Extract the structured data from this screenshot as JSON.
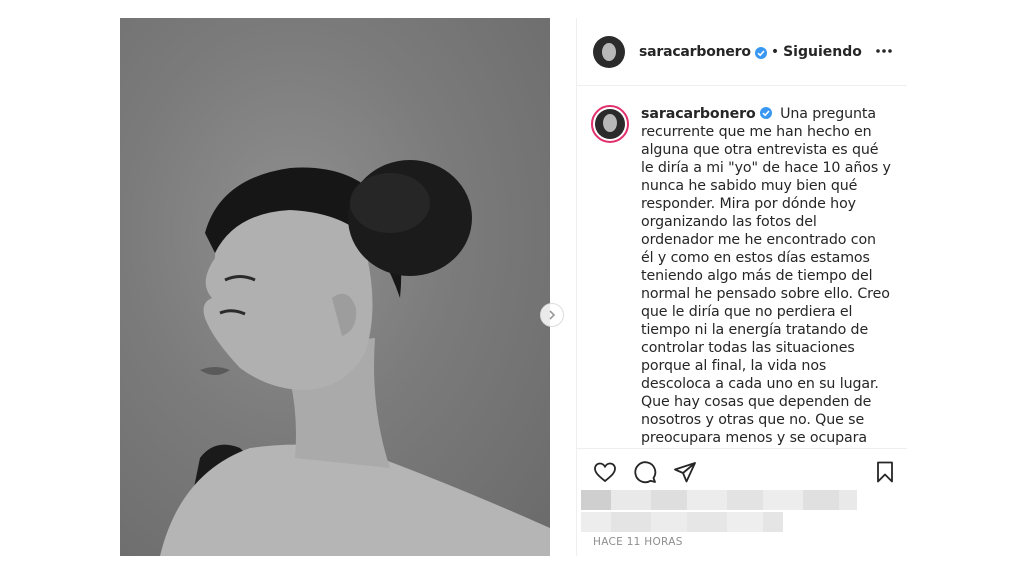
{
  "post": {
    "username": "saracarbonero",
    "follow_status": "Siguiendo",
    "separator": "•",
    "caption": "Una pregunta recurrente que me han hecho en alguna que otra entrevista es qué le diría a mi \"yo\" de hace 10 años y nunca he sabido muy bien qué responder. Mira por dónde hoy organizando las fotos del ordenador me he encontrado con él y como en estos días estamos teniendo algo más de tiempo del normal he pensado sobre ello. Creo que le diría que no perdiera el tiempo ni la energía tratando de controlar todas las situaciones porque al final, la vida nos descoloca a cada uno en su lugar. Que hay cosas que dependen de nosotros y otras que no. Que se preocupara menos y se ocupara",
    "timestamp": "HACE 11 HORAS"
  },
  "icons": {
    "verified": "verified-badge-icon",
    "more": "more-options-icon",
    "like": "heart-icon",
    "comment": "comment-icon",
    "share": "share-icon",
    "save": "bookmark-icon",
    "next": "chevron-right-icon"
  },
  "colors": {
    "verified": "#3897f0",
    "story_ring": "#e1306c",
    "text": "#262626",
    "muted": "#8e8e8e",
    "border": "#efefef"
  }
}
